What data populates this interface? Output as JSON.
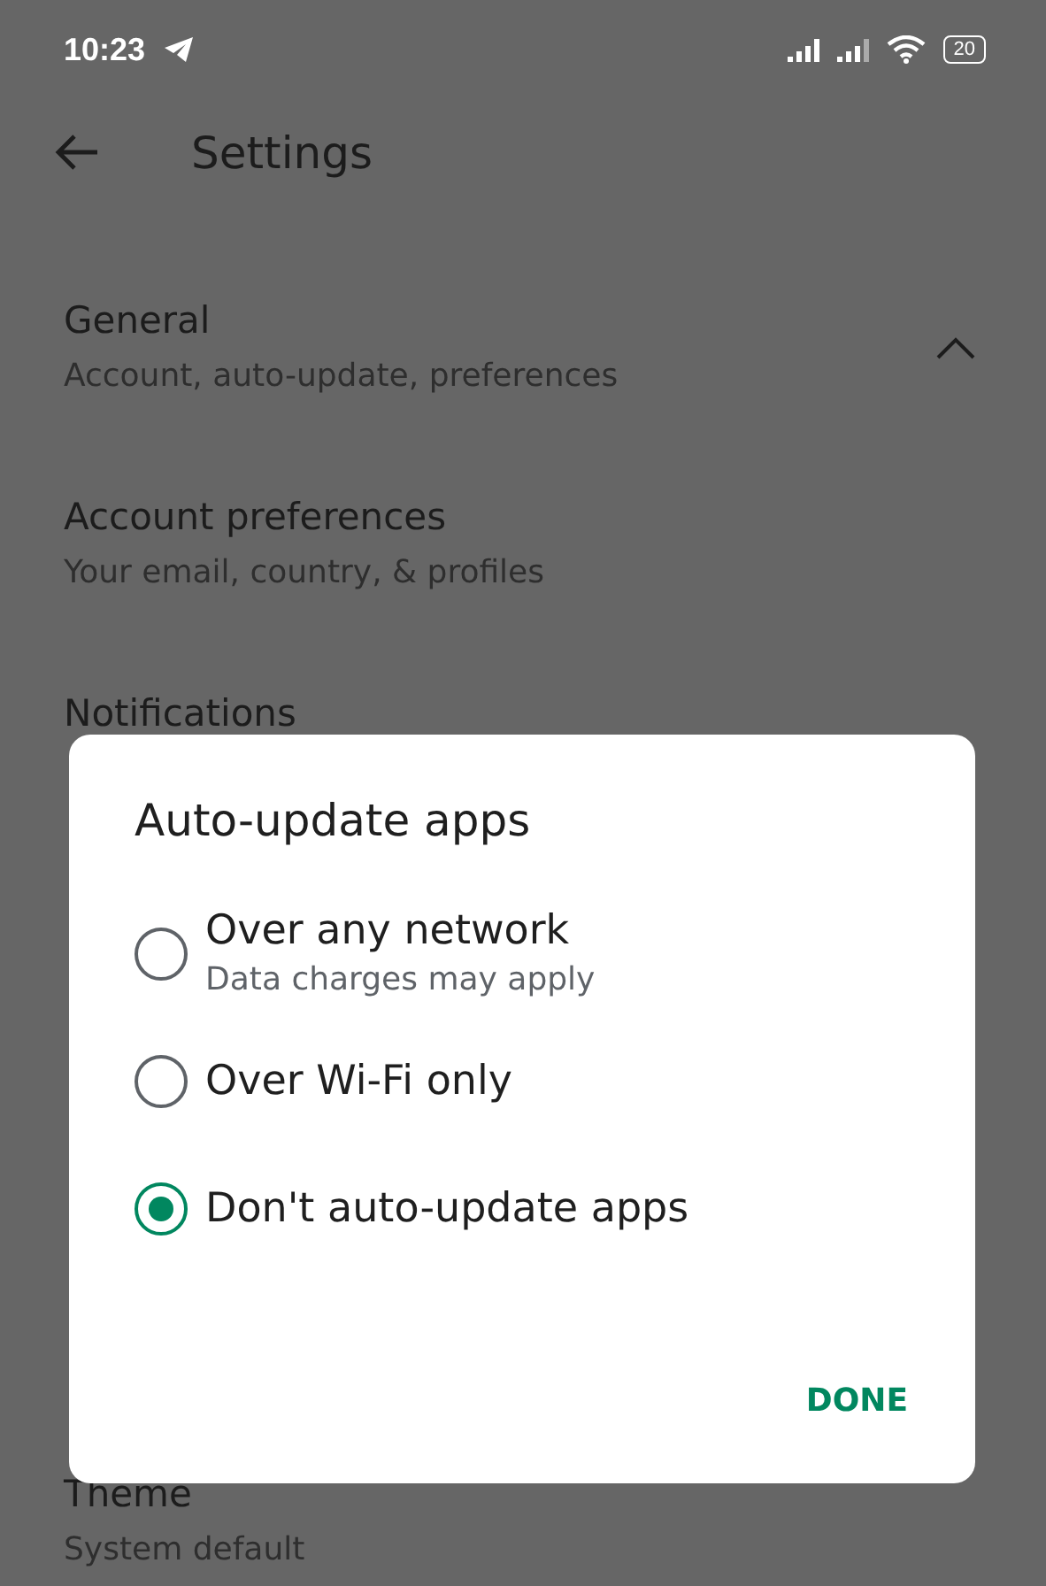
{
  "status_bar": {
    "time": "10:23",
    "battery": "20"
  },
  "app_bar": {
    "title": "Settings"
  },
  "general": {
    "title": "General",
    "subtitle": "Account, auto-update, preferences",
    "expanded": true
  },
  "settings_items": [
    {
      "title": "Account preferences",
      "subtitle": "Your email, country, & profiles"
    },
    {
      "title": "Notifications"
    }
  ],
  "bottom_item": {
    "title": "Theme",
    "subtitle": "System default"
  },
  "dialog": {
    "title": "Auto-update apps",
    "options": [
      {
        "label": "Over any network",
        "sublabel": "Data charges may apply",
        "selected": false
      },
      {
        "label": "Over Wi-Fi only",
        "selected": false
      },
      {
        "label": "Don't auto-update apps",
        "selected": true
      }
    ],
    "button": "DONE"
  }
}
